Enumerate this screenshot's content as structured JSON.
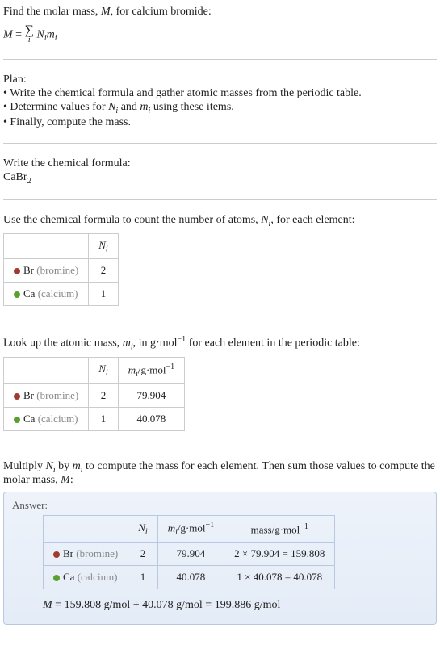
{
  "intro": {
    "line1_pre": "Find the molar mass, ",
    "line1_var": "M",
    "line1_post": ", for calcium bromide:",
    "eq_lhs": "M",
    "eq_eq": " = ",
    "sum_sym": "∑",
    "sum_idx": "i",
    "eq_rhs_N": "N",
    "eq_rhs_m": "m"
  },
  "plan": {
    "header": "Plan:",
    "b1_pre": "• Write the chemical formula and gather atomic masses from the periodic table.",
    "b2_pre": "• Determine values for ",
    "b2_N": "N",
    "b2_mid": " and ",
    "b2_m": "m",
    "b2_post": " using these items.",
    "b3": "• Finally, compute the mass."
  },
  "step1": {
    "header": "Write the chemical formula:",
    "formula_main": "CaBr",
    "formula_sub": "2"
  },
  "step2": {
    "pre": "Use the chemical formula to count the number of atoms, ",
    "N": "N",
    "post": ", for each element:",
    "h_N": "N",
    "h_i": "i",
    "r1_sym": "Br",
    "r1_name": "(bromine)",
    "r1_N": "2",
    "r2_sym": "Ca",
    "r2_name": "(calcium)",
    "r2_N": "1"
  },
  "step3": {
    "pre": "Look up the atomic mass, ",
    "m": "m",
    "mid": ", in g·mol",
    "exp": "−1",
    "post": " for each element in the periodic table:",
    "h_N": "N",
    "h_m": "m",
    "h_unit": "/g·mol",
    "r1_sym": "Br",
    "r1_name": "(bromine)",
    "r1_N": "2",
    "r1_m": "79.904",
    "r2_sym": "Ca",
    "r2_name": "(calcium)",
    "r2_N": "1",
    "r2_m": "40.078"
  },
  "step4": {
    "pre": "Multiply ",
    "N": "N",
    "mid1": " by ",
    "m": "m",
    "mid2": " to compute the mass for each element. Then sum those values to compute the molar mass, ",
    "M": "M",
    "post": ":"
  },
  "answer": {
    "label": "Answer:",
    "h_N": "N",
    "h_m": "m",
    "h_unit": "/g·mol",
    "h_mass": "mass/g·mol",
    "exp": "−1",
    "r1_sym": "Br",
    "r1_name": "(bromine)",
    "r1_N": "2",
    "r1_m": "79.904",
    "r1_mass": "2 × 79.904 = 159.808",
    "r2_sym": "Ca",
    "r2_name": "(calcium)",
    "r2_N": "1",
    "r2_m": "40.078",
    "r2_mass": "1 × 40.078 = 40.078",
    "final_M": "M",
    "final_eq": " = 159.808 g/mol + 40.078 g/mol = 199.886 g/mol"
  },
  "colors": {
    "br": "#a23b2e",
    "ca": "#5aa02c"
  },
  "chart_data": {
    "type": "table",
    "title": "Molar mass of CaBr2",
    "series": [
      {
        "element": "Br",
        "name": "bromine",
        "N_i": 2,
        "m_i_g_per_mol": 79.904,
        "mass_g_per_mol": 159.808
      },
      {
        "element": "Ca",
        "name": "calcium",
        "N_i": 1,
        "m_i_g_per_mol": 40.078,
        "mass_g_per_mol": 40.078
      }
    ],
    "total_molar_mass_g_per_mol": 199.886
  }
}
